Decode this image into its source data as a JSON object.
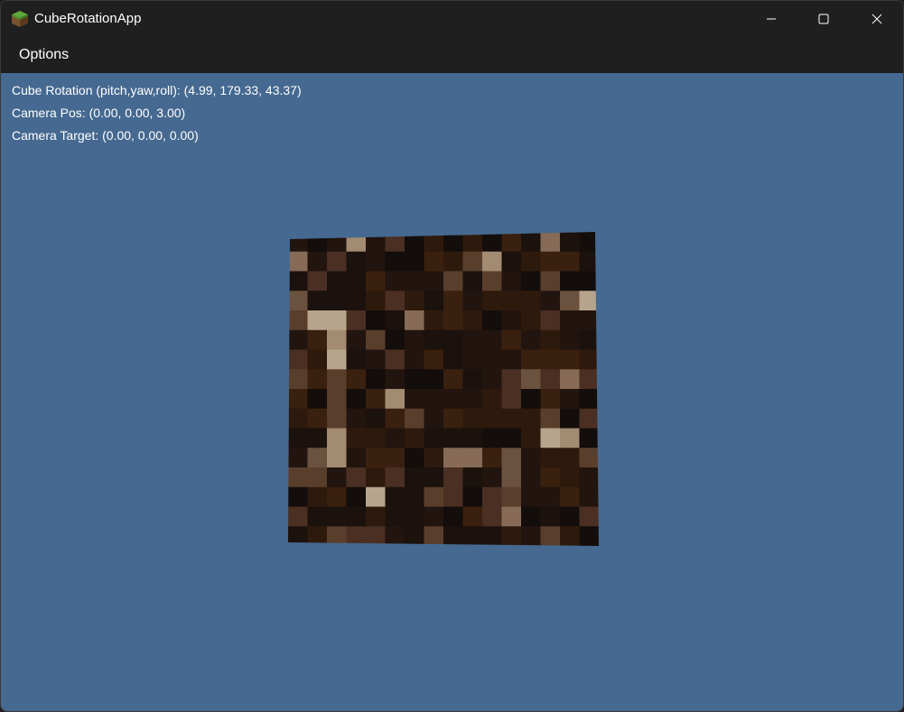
{
  "window": {
    "title": "CubeRotationApp",
    "icon": "grass-block-icon",
    "controls": {
      "minimize": "minimize-icon",
      "maximize": "maximize-icon",
      "close": "close-icon"
    }
  },
  "menu": {
    "items": [
      {
        "label": "Options"
      }
    ]
  },
  "overlay": {
    "rotation": "Cube Rotation (pitch,yaw,roll): (4.99, 179.33, 43.37)",
    "camera_pos": "Camera Pos: (0.00, 0.00, 3.00)",
    "camera_target": "Camera Target: (0.00, 0.00, 0.00)"
  },
  "scene": {
    "background_color": "#456990",
    "cube_texture": "dirt-block-texture",
    "texture_palette": [
      "#130d0b",
      "#1b110d",
      "#22140e",
      "#2e1a0c",
      "#3a200e",
      "#4a2f22",
      "#5a3e2c",
      "#6b523f",
      "#876b56",
      "#a38b72",
      "#b7a48c"
    ]
  }
}
